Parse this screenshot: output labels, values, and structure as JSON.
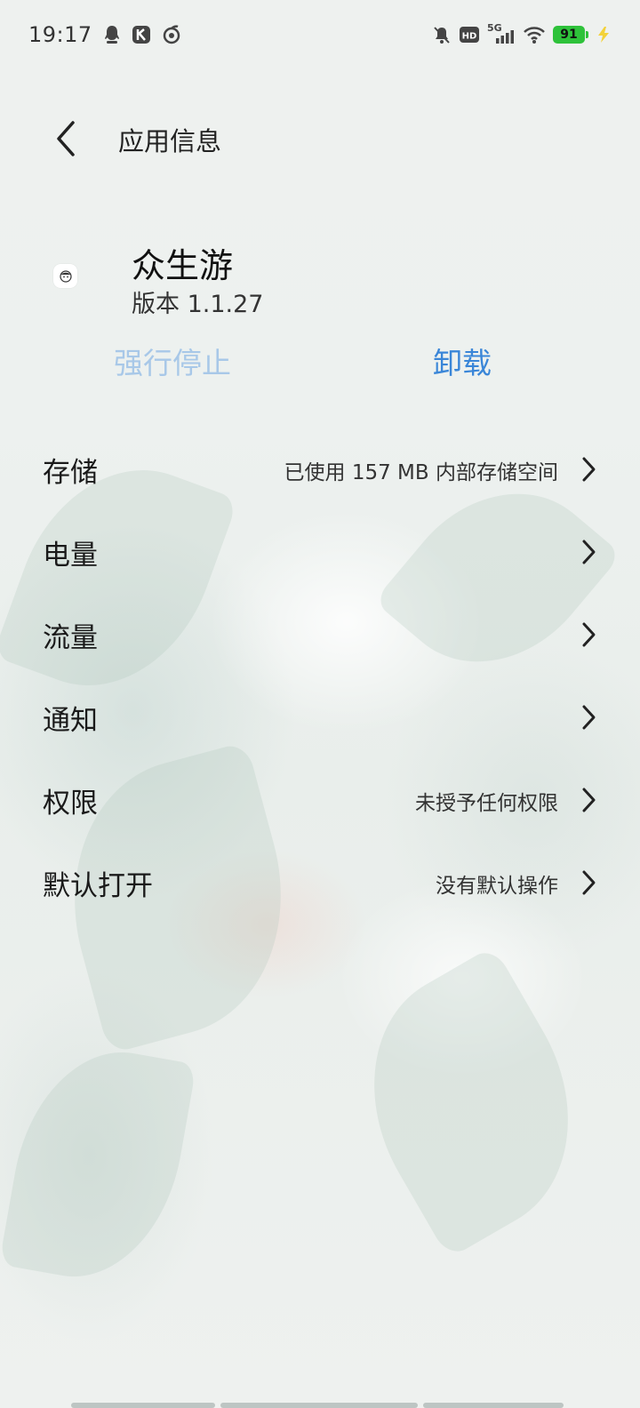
{
  "status_bar": {
    "time": "19:17",
    "battery": "91",
    "network": "5G",
    "left_icons": [
      "qq-penguin-icon",
      "k-app-icon",
      "swirl-app-icon"
    ],
    "right_icons": [
      "bell-muted-icon",
      "hd-icon",
      "signal-5g-icon",
      "wifi-icon",
      "battery-icon",
      "charging-icon"
    ]
  },
  "header": {
    "title": "应用信息",
    "back_icon": "chevron-left-icon"
  },
  "app": {
    "name": "众生游",
    "version": "版本 1.1.27",
    "icon": "app-logo-icon"
  },
  "actions": {
    "force_stop": "强行停止",
    "uninstall": "卸载",
    "force_stop_color": "#a8c8e8",
    "uninstall_color": "#3a86d8"
  },
  "settings": [
    {
      "label": "存储",
      "value": "已使用 157 MB 内部存储空间"
    },
    {
      "label": "电量",
      "value": ""
    },
    {
      "label": "流量",
      "value": ""
    },
    {
      "label": "通知",
      "value": ""
    },
    {
      "label": "权限",
      "value": "未授予任何权限"
    },
    {
      "label": "默认打开",
      "value": "没有默认操作"
    }
  ]
}
